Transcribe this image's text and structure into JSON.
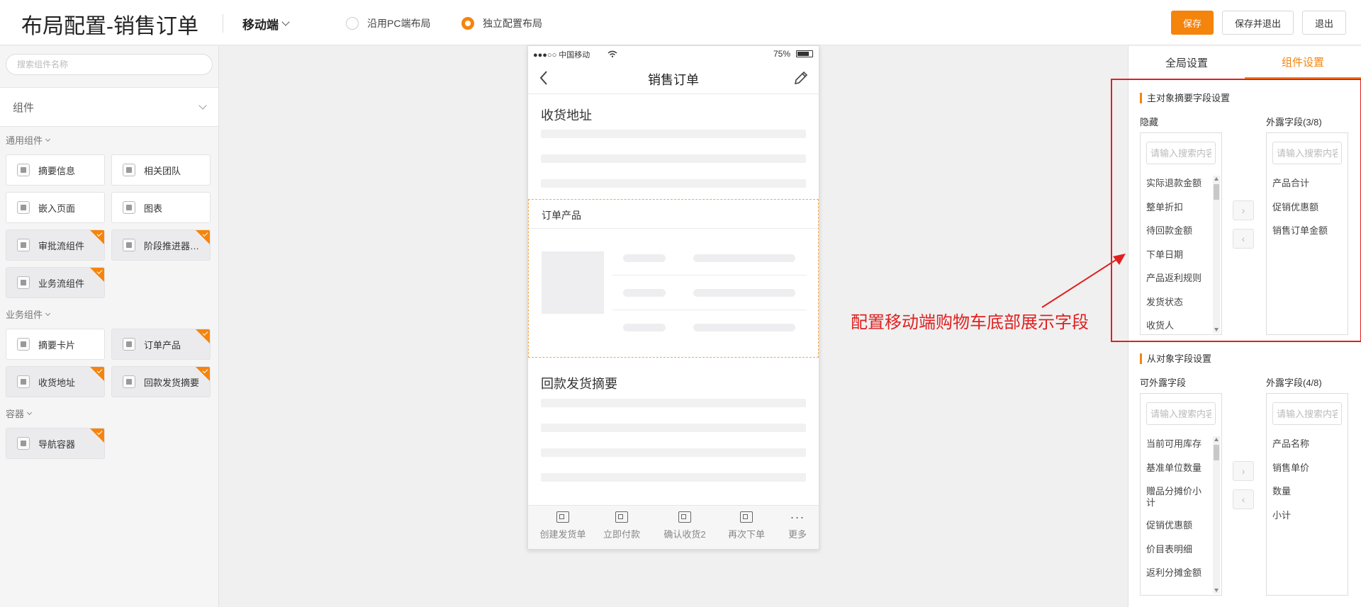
{
  "header": {
    "title": "布局配置-销售订单",
    "device": "移动端",
    "layout_options": [
      "沿用PC端布局",
      "独立配置布局"
    ],
    "selected_layout": "独立配置布局",
    "buttons": {
      "save": "保存",
      "save_exit": "保存并退出",
      "exit": "退出"
    }
  },
  "left_panel": {
    "search_placeholder": "搜索组件名称",
    "components_title": "组件",
    "groups": [
      {
        "label": "通用组件",
        "items": [
          {
            "label": "摘要信息",
            "used": false
          },
          {
            "label": "相关团队",
            "used": false
          },
          {
            "label": "嵌入页面",
            "used": false
          },
          {
            "label": "图表",
            "used": false
          },
          {
            "label": "审批流组件",
            "used": true
          },
          {
            "label": "阶段推进器组件",
            "used": true
          },
          {
            "label": "业务流组件",
            "used": true
          }
        ]
      },
      {
        "label": "业务组件",
        "items": [
          {
            "label": "摘要卡片",
            "used": false
          },
          {
            "label": "订单产品",
            "used": true
          },
          {
            "label": "收货地址",
            "used": true
          },
          {
            "label": "回款发货摘要",
            "used": true
          }
        ]
      },
      {
        "label": "容器",
        "items": [
          {
            "label": "导航容器",
            "used": true
          }
        ]
      }
    ]
  },
  "phone": {
    "status": {
      "carrier": "●●●○○ 中国移动",
      "battery": "75%"
    },
    "title": "销售订单",
    "sections": {
      "address": "收货地址",
      "order_products": "订单产品",
      "payment_summary": "回款发货摘要"
    },
    "actions": [
      "创建发货单",
      "立即付款",
      "确认收货2",
      "再次下单",
      "更多"
    ],
    "more_glyph": "···"
  },
  "annotation": "配置移动端购物车底部展示字段",
  "right_panel": {
    "tabs": [
      "全局设置",
      "组件设置"
    ],
    "active_tab": "组件设置",
    "main_settings": {
      "title": "主对象摘要字段设置",
      "hidden_label": "隐藏",
      "exposed_label": "外露字段(3/8)",
      "search_placeholder": "请输入搜索内容",
      "hidden_fields": [
        "实际退款金额",
        "整单折扣",
        "待回款金额",
        "下单日期",
        "产品返利规则",
        "发货状态",
        "收货人"
      ],
      "exposed_fields": [
        "产品合计",
        "促销优惠额",
        "销售订单金额"
      ]
    },
    "sub_settings": {
      "title": "从对象字段设置",
      "available_label": "可外露字段",
      "exposed_label": "外露字段(4/8)",
      "search_placeholder": "请输入搜索内容",
      "available_fields": [
        "当前可用库存",
        "基准单位数量",
        "赠品分摊价小计",
        "促销优惠额",
        "价目表明细",
        "返利分摊金额"
      ],
      "exposed_fields": [
        "产品名称",
        "销售单价",
        "数量",
        "小计"
      ]
    },
    "arrow_right": "›",
    "arrow_left": "‹"
  }
}
